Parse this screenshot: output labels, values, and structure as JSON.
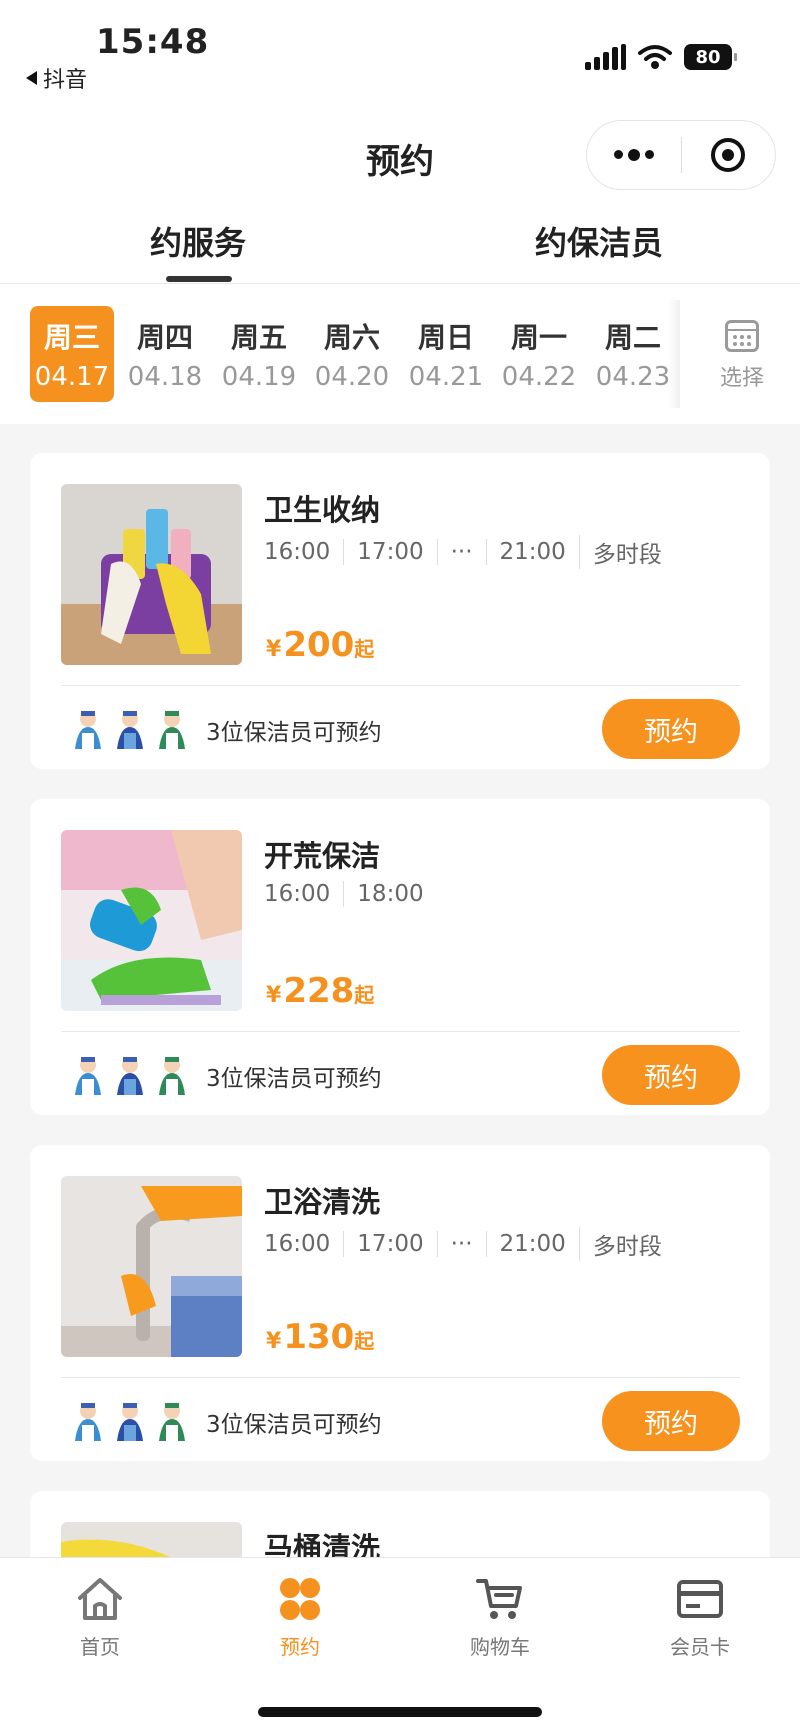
{
  "status": {
    "time": "15:48",
    "back_app": "抖音",
    "battery": "80"
  },
  "nav": {
    "title": "预约"
  },
  "tabs": [
    {
      "label": "约服务",
      "active": true
    },
    {
      "label": "约保洁员",
      "active": false
    }
  ],
  "dates": [
    {
      "weekday": "周三",
      "date": "04.17",
      "active": true
    },
    {
      "weekday": "周四",
      "date": "04.18",
      "active": false
    },
    {
      "weekday": "周五",
      "date": "04.19",
      "active": false
    },
    {
      "weekday": "周六",
      "date": "04.20",
      "active": false
    },
    {
      "weekday": "周日",
      "date": "04.21",
      "active": false
    },
    {
      "weekday": "周一",
      "date": "04.22",
      "active": false
    },
    {
      "weekday": "周二",
      "date": "04.23",
      "active": false
    }
  ],
  "date_picker": {
    "label": "选择",
    "icon": "calendar-icon"
  },
  "services": [
    {
      "title": "卫生收纳",
      "slots": [
        "16:00",
        "17:00",
        "···",
        "21:00",
        "多时段"
      ],
      "price_currency": "¥",
      "price": "200",
      "price_suffix": "起",
      "cleaners": "3位保洁员可预约",
      "button": "预约"
    },
    {
      "title": "开荒保洁",
      "slots": [
        "16:00",
        "18:00"
      ],
      "price_currency": "¥",
      "price": "228",
      "price_suffix": "起",
      "cleaners": "3位保洁员可预约",
      "button": "预约"
    },
    {
      "title": "卫浴清洗",
      "slots": [
        "16:00",
        "17:00",
        "···",
        "21:00",
        "多时段"
      ],
      "price_currency": "¥",
      "price": "130",
      "price_suffix": "起",
      "cleaners": "3位保洁员可预约",
      "button": "预约"
    },
    {
      "title": "马桶清洗"
    }
  ],
  "tabbar": [
    {
      "label": "首页",
      "icon": "home-icon",
      "active": false
    },
    {
      "label": "预约",
      "icon": "booking-icon",
      "active": true
    },
    {
      "label": "购物车",
      "icon": "cart-icon",
      "active": false
    },
    {
      "label": "会员卡",
      "icon": "member-card-icon",
      "active": false
    }
  ],
  "colors": {
    "accent": "#f5911e",
    "background": "#f5f5f5"
  }
}
